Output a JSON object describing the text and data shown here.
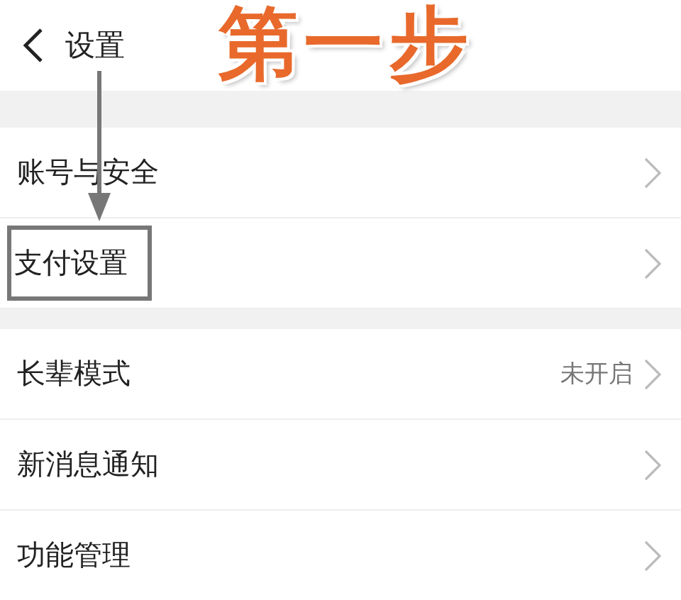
{
  "header": {
    "title": "设置"
  },
  "annotation": {
    "step_label": "第一步"
  },
  "groups": [
    {
      "rows": [
        {
          "label": "账号与安全",
          "highlighted": false
        },
        {
          "label": "支付设置",
          "highlighted": true
        }
      ]
    },
    {
      "rows": [
        {
          "label": "长辈模式",
          "value": "未开启",
          "highlighted": false
        },
        {
          "label": "新消息通知",
          "highlighted": false
        },
        {
          "label": "功能管理",
          "highlighted": false
        }
      ]
    }
  ]
}
